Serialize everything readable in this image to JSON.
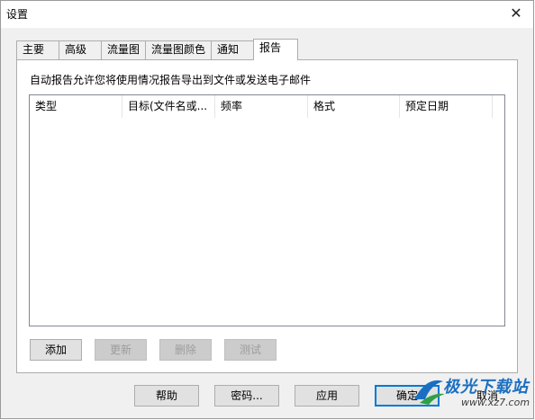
{
  "window": {
    "title": "设置",
    "close_glyph": "✕"
  },
  "tabs": [
    {
      "label": "主要"
    },
    {
      "label": "高级"
    },
    {
      "label": "流量图"
    },
    {
      "label": "流量图颜色"
    },
    {
      "label": "通知"
    },
    {
      "label": "报告",
      "active": true
    }
  ],
  "report": {
    "description": "自动报告允许您将使用情况报告导出到文件或发送电子邮件",
    "columns": [
      "类型",
      "目标(文件名或...",
      "频率",
      "格式",
      "预定日期"
    ],
    "buttons": {
      "add": "添加",
      "update": "更新",
      "delete": "删除",
      "test": "测试"
    }
  },
  "footer": {
    "help": "帮助",
    "password": "密码...",
    "apply": "应用",
    "ok": "确定",
    "cancel": "取消"
  },
  "watermark": {
    "text": "极光下载站",
    "url": "www.xz7.com"
  }
}
